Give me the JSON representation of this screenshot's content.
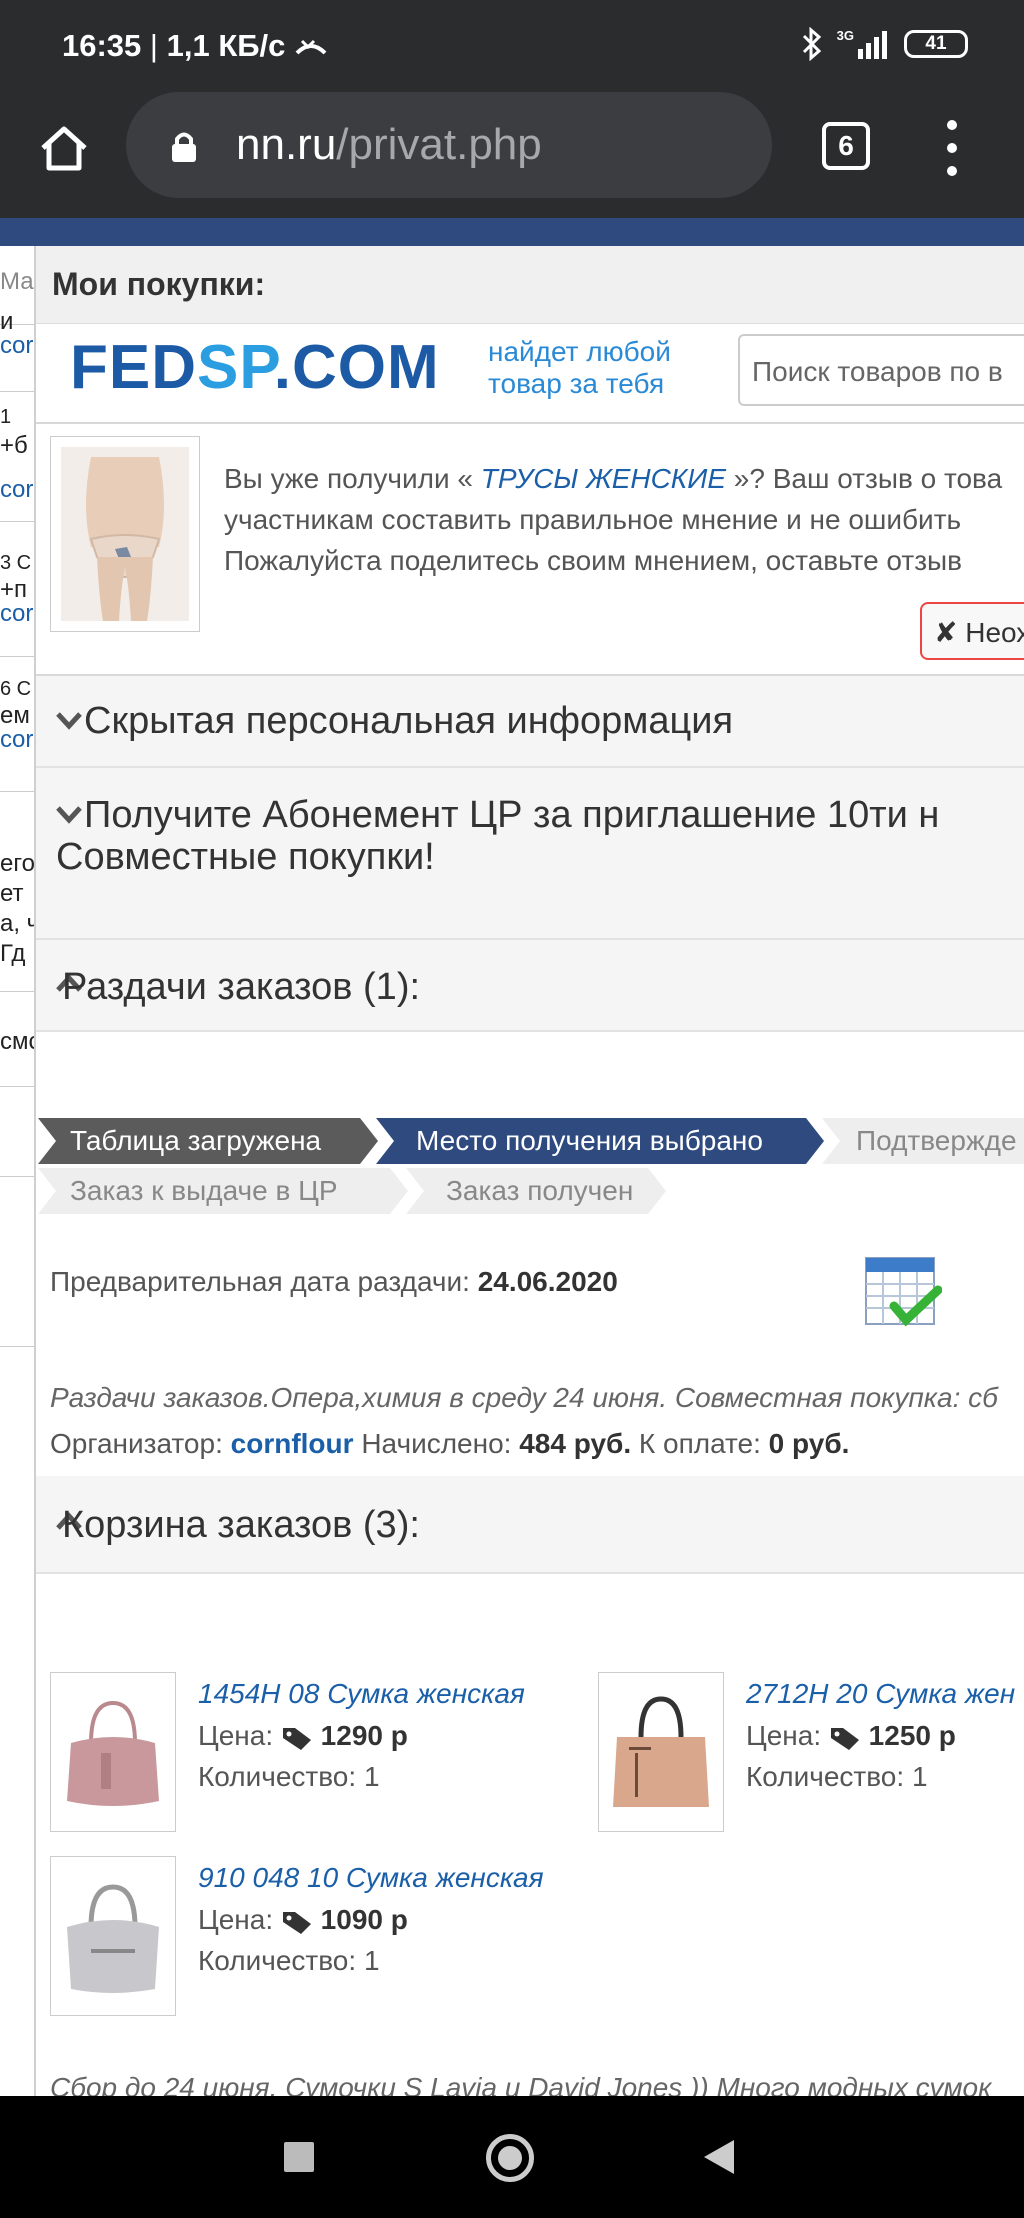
{
  "status_bar": {
    "time": "16:35",
    "separator": "|",
    "net_rate": "1,1 КБ/с",
    "network": "3G",
    "battery": "41"
  },
  "browser": {
    "url_domain": "nn.ru",
    "url_path": "/privat.php",
    "tab_count": "6"
  },
  "modal": {
    "title": "Мои покупки:"
  },
  "ad": {
    "brand_a": "FED",
    "brand_b": "SP",
    "brand_c": ".COM",
    "tagline_1": "найдет любой",
    "tagline_2": "товар за тебя",
    "search_placeholder": "Поиск товаров по в"
  },
  "review": {
    "line1_prefix": "Вы уже получили «",
    "product": "ТРУСЫ ЖЕНСКИЕ",
    "line1_suffix": "»? Ваш отзыв о това",
    "line2": "участникам составить правильное мнение и не ошибить",
    "line3": "Пожалуйста поделитесь своим мнением, оставьте отзыв",
    "dismiss_icon": "✘",
    "dismiss_label": "Неох"
  },
  "sections": {
    "hidden_info": "Скрытая персональная информация",
    "promo_line1": "Получите Абонемент ЦР за приглашение 10ти н",
    "promo_line2": "Совместные покупки!",
    "distribution": "Раздачи заказов (1):",
    "cart": "Корзина заказов (3):"
  },
  "steps": [
    {
      "label": "Таблица загружена",
      "state": "done",
      "color": "#5b5b5b"
    },
    {
      "label": "Место получения выбрано",
      "state": "done",
      "color": "#2f4a7f"
    },
    {
      "label": "Подтвержде",
      "state": "todo",
      "color": "#eeeeee"
    },
    {
      "label": "Заказ к выдаче в ЦР",
      "state": "todo",
      "color": "#eeeeee"
    },
    {
      "label": "Заказ получен",
      "state": "todo",
      "color": "#eeeeee"
    }
  ],
  "distribution": {
    "date_label": "Предварительная дата раздачи:",
    "date_value": "24.06.2020",
    "note": "Раздачи заказов.Опера,химия в среду 24 июня. Совместная покупка: сб",
    "organizer_label": "Организатор:",
    "organizer": "cornflour",
    "accrued_label": "Начислено:",
    "accrued": "484 руб.",
    "to_pay_label": "К оплате:",
    "to_pay": "0 руб."
  },
  "cart": {
    "price_label": "Цена:",
    "qty_label": "Количество:",
    "items": [
      {
        "name": "1454H 08 Сумка женская",
        "price": "1290 р",
        "qty": "1",
        "color": "#c9989c"
      },
      {
        "name": "2712H 20 Сумка жен",
        "price": "1250 р",
        "qty": "1",
        "color": "#d9a88c"
      },
      {
        "name": "910 048 10 Сумка женская",
        "price": "1090 р",
        "qty": "1",
        "color": "#c8c8cc"
      }
    ],
    "footer_note": "Сбор до 24 июня. Сумочки S Lavia и David Jones )) Много модных сумок"
  },
  "background_page": {
    "frag_1": "Ма",
    "frag_2": "и",
    "frag_3": "cor",
    "frag_4": "1",
    "frag_5": "+б",
    "frag_6": "cor",
    "frag_7": "3 С",
    "frag_8": "+п",
    "frag_9": "cor",
    "frag_10": "6 С",
    "frag_11": "ем",
    "frag_12": "cor",
    "frag_13": "его",
    "frag_14": "ет",
    "frag_15": "а, ч",
    "frag_16": "Гд",
    "frag_17": "смс"
  },
  "colors": {
    "link": "#1a5fa8",
    "browser_chrome": "#2b2c2e",
    "brand_blue": "#1c5aa6",
    "step_done_dark": "#5b5b5b",
    "step_done_blue": "#2f4a7f"
  }
}
